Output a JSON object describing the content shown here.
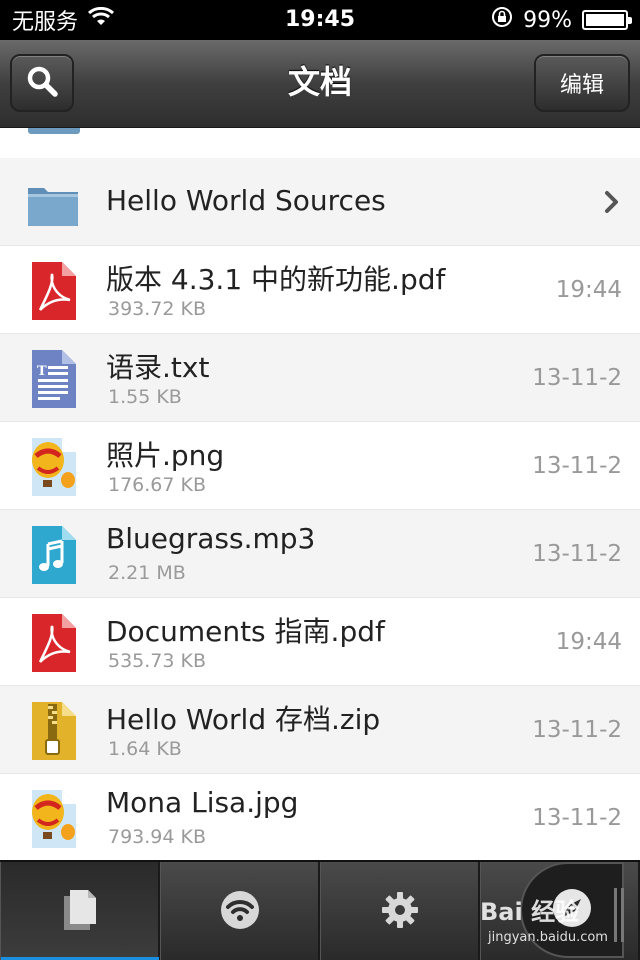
{
  "status_bar": {
    "carrier": "无服务",
    "time": "19:45",
    "battery": "99%",
    "battery_level": 0.99
  },
  "nav": {
    "title": "文档",
    "edit_label": "编辑"
  },
  "folder": {
    "name": "Hello World Sources"
  },
  "files": [
    {
      "name": "版本 4.3.1 中的新功能.pdf",
      "size": "393.72 KB",
      "date": "19:44",
      "icon": "pdf-icon"
    },
    {
      "name": "语录.txt",
      "size": "1.55 KB",
      "date": "13-11-2",
      "icon": "text-file-icon"
    },
    {
      "name": "照片.png",
      "size": "176.67 KB",
      "date": "13-11-2",
      "icon": "image-balloon-icon"
    },
    {
      "name": "Bluegrass.mp3",
      "size": "2.21 MB",
      "date": "13-11-2",
      "icon": "audio-file-icon"
    },
    {
      "name": "Documents 指南.pdf",
      "size": "535.73 KB",
      "date": "19:44",
      "icon": "pdf-icon"
    },
    {
      "name": "Hello World 存档.zip",
      "size": "1.64 KB",
      "date": "13-11-2",
      "icon": "zip-file-icon"
    },
    {
      "name": "Mona Lisa.jpg",
      "size": "793.94 KB",
      "date": "13-11-2",
      "icon": "image-balloon-icon"
    }
  ],
  "tabs": [
    {
      "name": "documents",
      "icon": "document-icon",
      "active": true
    },
    {
      "name": "wifi",
      "icon": "wifi-icon",
      "active": false
    },
    {
      "name": "settings",
      "icon": "gear-icon",
      "active": false
    },
    {
      "name": "browser",
      "icon": "compass-icon",
      "active": false
    }
  ],
  "watermark": {
    "brand": "Bai 经验",
    "url": "jingyan.baidu.com"
  },
  "colors": {
    "accent": "#1a8fe0",
    "pdf": "#d8262b",
    "folder": "#7aa7cc",
    "txt": "#6d83c4",
    "audio": "#2fa8cf",
    "zip": "#e2b22b"
  }
}
